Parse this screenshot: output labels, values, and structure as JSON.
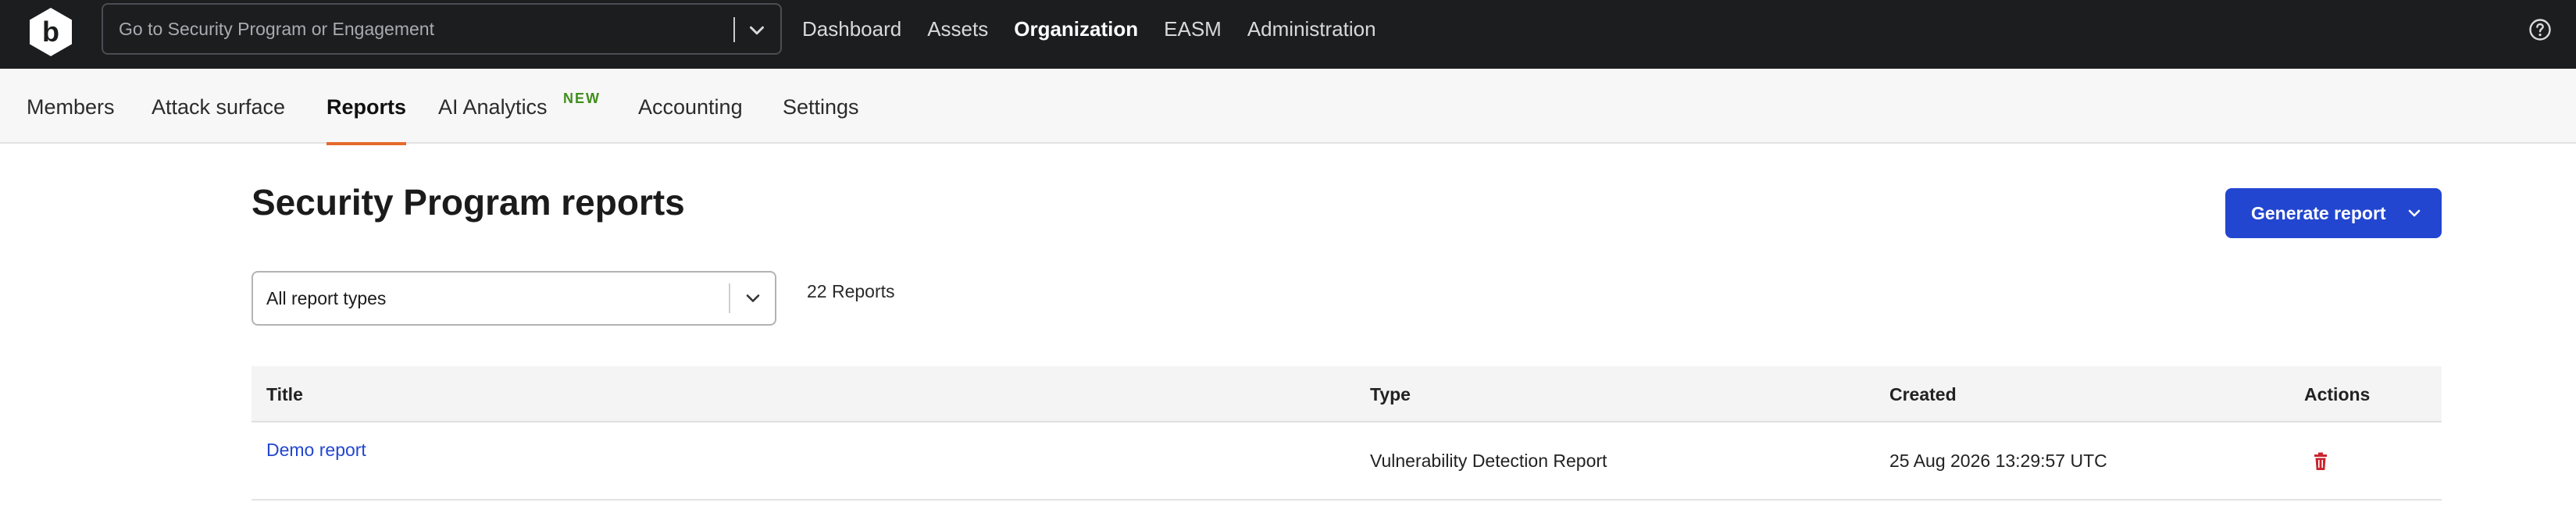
{
  "topbar": {
    "logo_letter": "b",
    "search": {
      "placeholder": "Go to Security Program or Engagement"
    },
    "nav": [
      {
        "label": "Dashboard",
        "active": false
      },
      {
        "label": "Assets",
        "active": false
      },
      {
        "label": "Organization",
        "active": true
      },
      {
        "label": "EASM",
        "active": false
      },
      {
        "label": "Administration",
        "active": false
      }
    ],
    "help_icon": "question-circle-icon"
  },
  "subnav": {
    "tabs": [
      {
        "label": "Members",
        "active": false
      },
      {
        "label": "Attack surface",
        "active": false
      },
      {
        "label": "Reports",
        "active": true
      },
      {
        "label": "AI Analytics",
        "active": false,
        "badge": "NEW"
      },
      {
        "label": "Accounting",
        "active": false
      },
      {
        "label": "Settings",
        "active": false
      }
    ]
  },
  "page": {
    "title": "Security Program reports",
    "generate_button": "Generate report",
    "filter": {
      "value": "All report types"
    },
    "count": "22 Reports"
  },
  "table": {
    "columns": [
      "Title",
      "Type",
      "Created",
      "Actions"
    ],
    "rows": [
      {
        "title": "Demo report",
        "type": "Vulnerability Detection Report",
        "created": "25 Aug 2026 13:29:57 UTC",
        "action_icon": "trash-icon"
      }
    ]
  },
  "colors": {
    "topbar_bg": "#1b1d1f",
    "accent_blue": "#2346d0",
    "active_tab_underline": "#e56a2c",
    "new_badge": "#3f8f1c",
    "delete_red": "#c8262f"
  }
}
